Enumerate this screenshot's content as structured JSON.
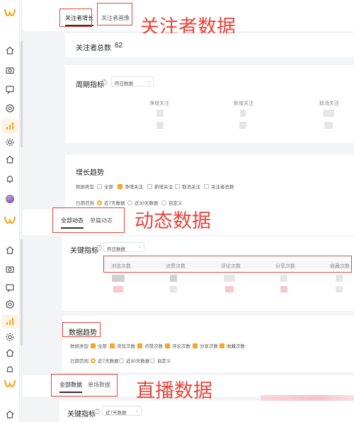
{
  "annotations": {
    "follower": "关注者数据",
    "dynamic": "动态数据",
    "live": "直播数据"
  },
  "section1": {
    "tabs": [
      "关注者增长",
      "关注者画像"
    ],
    "total_label": "关注者总数",
    "total_value": "62",
    "period_label": "周期指标",
    "period_select": "昨日数据",
    "metrics": [
      "净增关注",
      "新增关注",
      "取消关注"
    ],
    "trend_title": "增长趋势",
    "data_type_label": "数据类型",
    "data_type_options": [
      "全部",
      "净增关注",
      "新增关注",
      "取消关注",
      "关注者总数"
    ],
    "date_range_label": "日期范围",
    "date_range_options": [
      "近7天数据",
      "近30天数据",
      "自定义"
    ]
  },
  "section2": {
    "tabs": [
      "全部动态",
      "单篇动态"
    ],
    "key_label": "关键指标",
    "key_select": "昨日数据",
    "columns": [
      "浏览次数",
      "点赞次数",
      "评论次数",
      "分享次数",
      "收藏次数"
    ],
    "trend_title": "数据趋势",
    "data_type_label": "数据类型",
    "data_type_options": [
      "全部",
      "浏览次数",
      "点赞次数",
      "评论次数",
      "分享次数",
      "收藏次数"
    ],
    "date_range_label": "日期范围",
    "date_range_options": [
      "近7天数据",
      "近30天数据",
      "自定义"
    ]
  },
  "section3": {
    "tabs": [
      "全部数据",
      "单场数据"
    ],
    "key_label": "关键指标",
    "key_select": "近7天数据"
  },
  "colors": {
    "accent": "#f5a623",
    "annotation": "#e8453c"
  }
}
